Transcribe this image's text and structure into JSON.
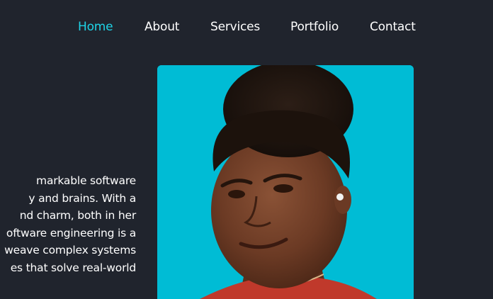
{
  "nav": {
    "items": [
      {
        "label": "Home",
        "active": true
      },
      {
        "label": "About",
        "active": false
      },
      {
        "label": "Services",
        "active": false
      },
      {
        "label": "Portfolio",
        "active": false
      },
      {
        "label": "Contact",
        "active": false
      }
    ]
  },
  "bio": {
    "lines": [
      "markable software",
      "y and brains. With a",
      "nd charm, both in her",
      "oftware engineering is a",
      "weave complex systems",
      "es that solve real-world"
    ]
  },
  "portrait": {
    "background_color": "#00bcd5"
  },
  "theme": {
    "background": "#20242d",
    "accent": "#1fd3e6",
    "text": "#ffffff"
  }
}
